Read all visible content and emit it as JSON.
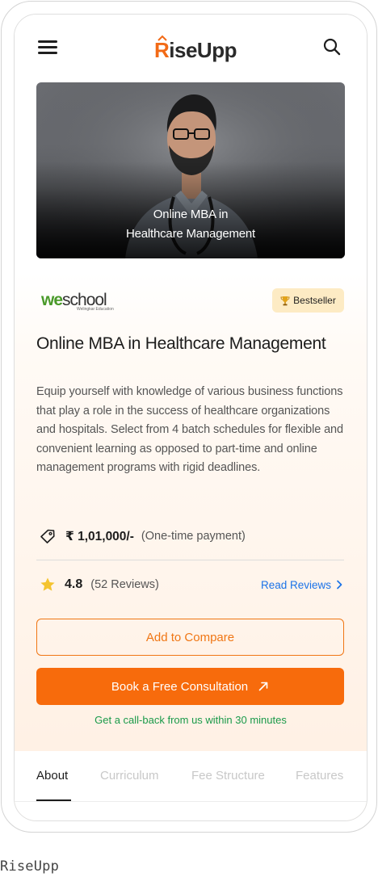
{
  "app": {
    "logo_first": "R",
    "logo_rest": "iseUpp",
    "brand_color": "#f26a16"
  },
  "header": {
    "menu_icon": "hamburger-menu-icon",
    "search_icon": "search-icon"
  },
  "hero": {
    "caption_line1": "Online MBA in",
    "caption_line2": "Healthcare Management"
  },
  "partner": {
    "logo_we": "we",
    "logo_school": "school",
    "logo_sub": "Welingkar Education"
  },
  "badge": {
    "label": "Bestseller",
    "icon": "trophy-icon",
    "bg_color": "#fdebc4"
  },
  "course": {
    "title": "Online MBA in Healthcare Management",
    "description": "Equip yourself with knowledge of various business functions that play a role in the success of healthcare organizations and hospitals. Select from 4 batch schedules for flexible and convenient learning as opposed to part-time and online management programs with rigid deadlines."
  },
  "price": {
    "value": "₹ 1,01,000/-",
    "note": "(One-time payment)",
    "icon": "price-tag-icon"
  },
  "rating": {
    "value": "4.8",
    "count": "(52 Reviews)",
    "icon": "star-icon",
    "read_reviews": "Read Reviews",
    "link_color": "#1a73e8"
  },
  "actions": {
    "compare_label": "Add to Compare",
    "book_label": "Book a Free Consultation",
    "callback_note": "Get a call-back from us within 30 minutes",
    "accent_color": "#f76b0c",
    "success_color": "#1a9a4a"
  },
  "tabs": [
    {
      "label": "About",
      "active": true
    },
    {
      "label": "Curriculum",
      "active": false
    },
    {
      "label": "Fee Structure",
      "active": false
    },
    {
      "label": "Features",
      "active": false
    }
  ],
  "page_label": "RiseUpp"
}
